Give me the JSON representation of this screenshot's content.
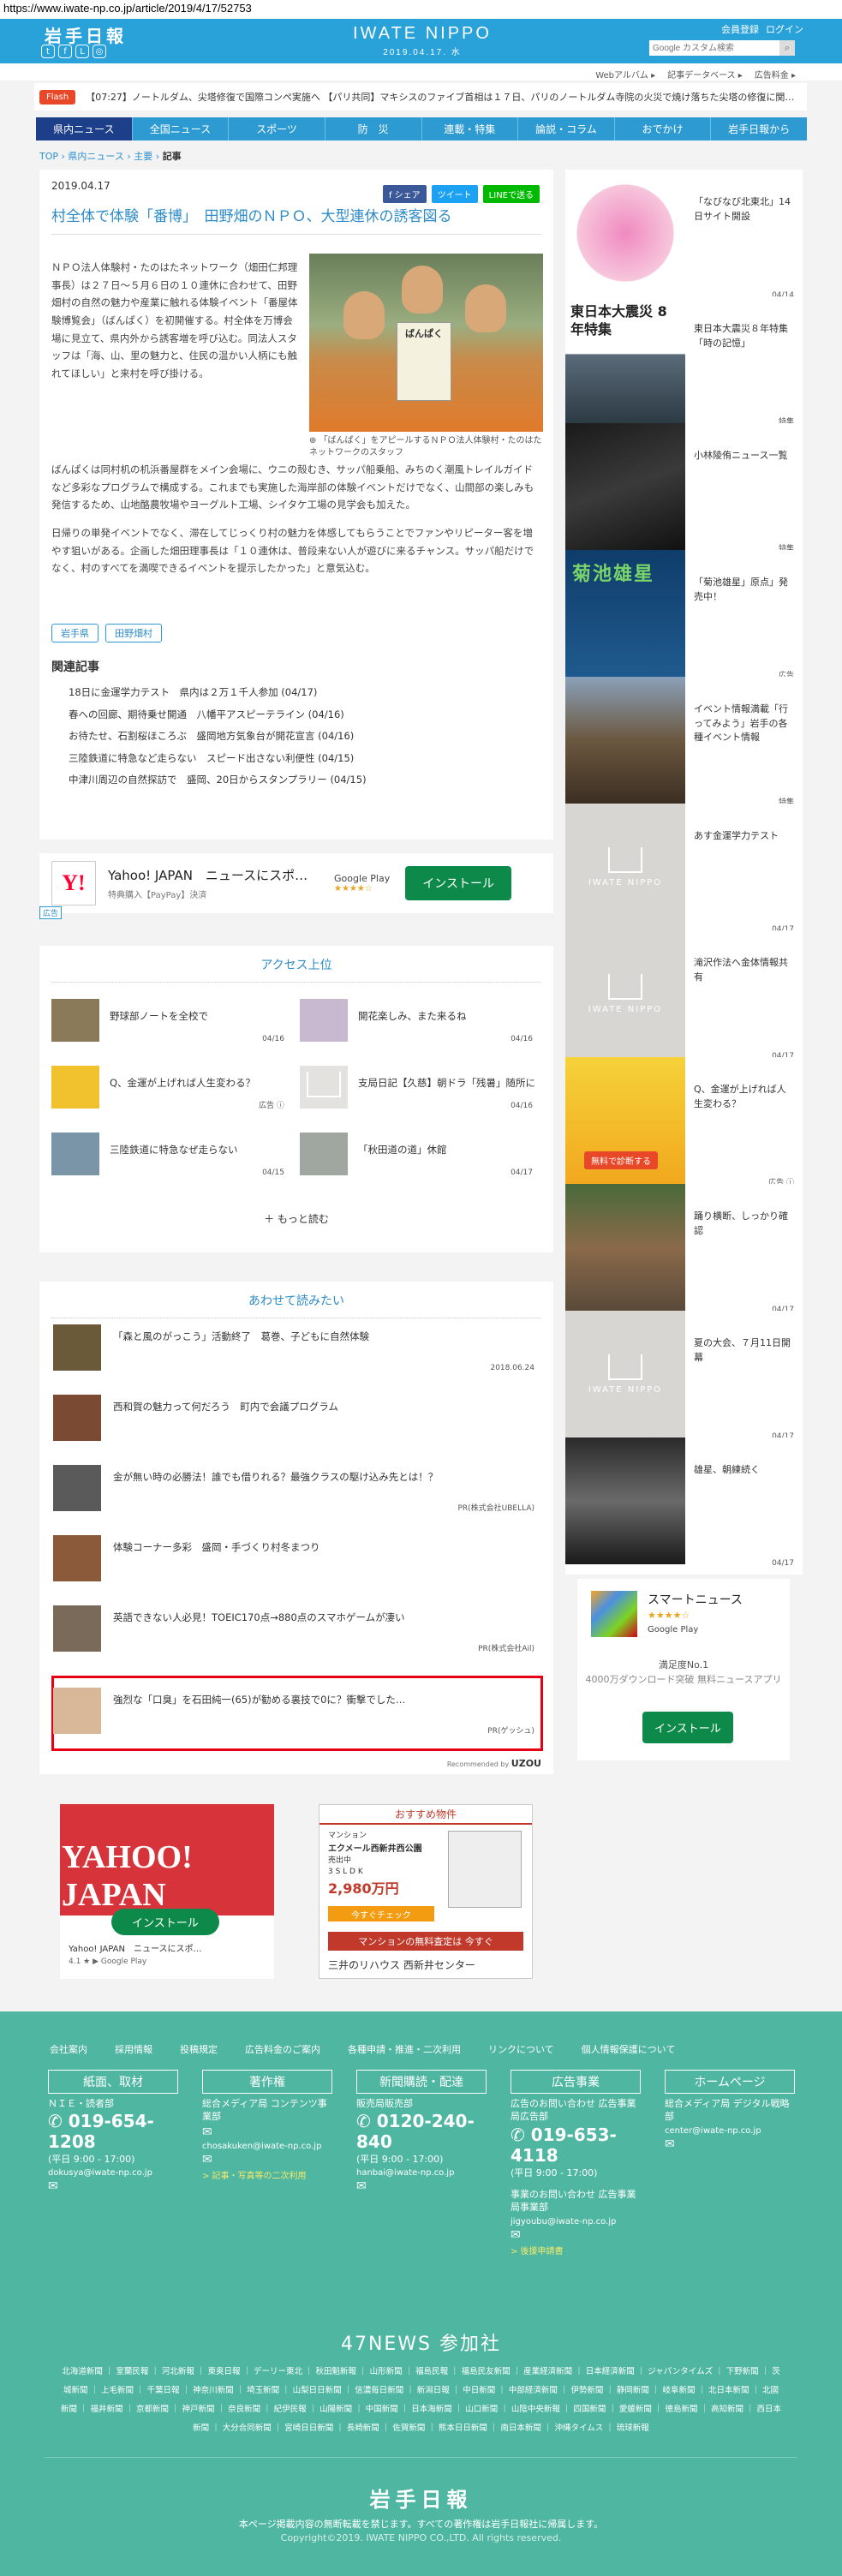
{
  "browser": {
    "url": "https://www.iwate-np.co.jp/article/2019/4/17/52753"
  },
  "header": {
    "logo": "岩手日報",
    "social_icons": [
      "twitter-icon",
      "facebook-icon",
      "line-icon",
      "instagram-icon"
    ],
    "site_name": "IWATE NIPPO",
    "site_date": "2019.04.17. 水",
    "member_register": "会員登録",
    "login": "ログイン",
    "search_placeholder": "Google カスタム検索",
    "brand_color": "#29a1d9"
  },
  "subnav": {
    "items": [
      "Webアルバム ▸",
      "記事データベース ▸",
      "広告料金 ▸"
    ]
  },
  "flash": {
    "label": "Flash",
    "text": "【07:27】ノートルダム、尖塔修復で国際コンペ実施へ 【パリ共同】マキシスのファイブ首相は１７日、パリのノートルダム寺院の火災で焼け落ちた尖塔の修復に関…"
  },
  "nav": {
    "items": [
      "県内ニュース",
      "全国ニュース",
      "スポーツ",
      "防　災",
      "連載・特集",
      "論説・コラム",
      "おでかけ",
      "岩手日報から"
    ],
    "active_color": "#1d3f8a"
  },
  "breadcrumb": {
    "top": "TOP",
    "sep": "›",
    "local": "県内ニュース",
    "main": "主要",
    "current": "記事"
  },
  "article": {
    "date": "2019.04.17",
    "share": {
      "facebook": "f シェア",
      "twitter": "ツイート",
      "line": "LINEで送る"
    },
    "title": "村全体で体験「番博」　田野畑のＮＰＯ、大型連休の誘客図る",
    "photo_book_text": "ばんぱく",
    "photo_caption": "「ばんぱく」をアピールするＮＰＯ法人体験村・たのはたネットワークのスタッフ",
    "para1": "ＮＰＯ法人体験村・たのはたネットワーク（畑田仁邦理事長）は２７日～５月６日の１０連休に合わせて、田野畑村の自然の魅力や産業に触れる体験イベント「番屋体験博覧会」（ばんぱく）を初開催する。村全体を万博会場に見立て、県内外から誘客増を呼び込む。同法人スタッフは「海、山、里の魅力と、住民の温かい人柄にも触れてほしい」と来村を呼び掛ける。",
    "para2": "ばんぱくは同村机の机浜番屋群をメイン会場に、ウニの殻むき、サッパ船乗船、みちのく潮風トレイルガイドなど多彩なプログラムで構成する。これまでも実施した海岸部の体験イベントだけでなく、山間部の楽しみも発信するため、山地酪農牧場やヨーグルト工場、シイタケ工場の見学会も加えた。",
    "para3": "日帰りの単発イベントでなく、滞在してじっくり村の魅力を体感してもらうことでファンやリピーター客を増やす狙いがある。企画した畑田理事長は「１０連休は、普段来ない人が遊びに来るチャンス。サッパ船だけでなく、村のすべてを満喫できるイベントを提示したかった」と意気込む。",
    "tags": [
      "岩手県",
      "田野畑村"
    ],
    "related_heading": "関連記事",
    "related": [
      "18日に金運学力テスト　県内は２万１千人参加 (04/17)",
      "春への回廊、期待乗せ開通　八幡平アスピーテライン (04/16)",
      "お待たせ、石割桜ほころぶ　盛岡地方気象台が開花宣言 (04/16)",
      "三陸鉄道に特急など走らない　スピード出さない利便性 (04/15)",
      "中津川周辺の自然探訪で　盛岡、20日からスタンプラリー (04/15)"
    ]
  },
  "app_banner": {
    "logo": "Y!",
    "name": "Yahoo! JAPAN　ニュースにスポ…",
    "sub": "特典購入【PayPay】決済",
    "store": "Google Play",
    "stars": "★★★★☆",
    "install": "インストール",
    "ad_label": "広告"
  },
  "access": {
    "heading": "アクセス上位",
    "items": [
      {
        "title": "野球部ノートを全校で",
        "date": "04/16"
      },
      {
        "title": "開花楽しみ、また来るね",
        "date": "04/16"
      },
      {
        "title": "Q、金運が上げれば人生変わる？",
        "date": "広告 ⓘ"
      },
      {
        "title": "支局日記【久慈】朝ドラ「残暑」随所に",
        "date": "04/16"
      },
      {
        "title": "三陸鉄道に特急なぜ走らない",
        "date": "04/15"
      },
      {
        "title": "「秋田道の道」休館",
        "date": "04/17"
      }
    ],
    "more": "＋ もっと読む"
  },
  "recommend": {
    "heading": "あわせて読みたい",
    "items": [
      {
        "title": "「森と風のがっこう」活動終了　葛巻、子どもに自然体験",
        "date": "2018.06.24"
      },
      {
        "title": "西和賀の魅力って何だろう　町内で会議プログラム",
        "date": ""
      },
      {
        "title": "金が無い時の必勝法！誰でも借りれる？最強クラスの駆け込み先とは！？",
        "date": "PR(株式会社UBELLA)"
      },
      {
        "title": "体験コーナー多彩　盛岡・手づくり村冬まつり",
        "date": ""
      },
      {
        "title": "英語できない人必見！TOEIC170点→880点のスマホゲームが凄い",
        "date": "PR(株式会社Ail)"
      },
      {
        "title": "強烈な「口臭」を石田純一(65)が勧める裏技で0に？衝撃でした…",
        "date": "PR(ゲッシュ)"
      }
    ],
    "recommended_by": "Recommended by",
    "uzou": "UZOU"
  },
  "bottom_ads": {
    "yahoo_logo": "YAHOO! JAPAN",
    "yahoo_install": "インストール",
    "yahoo_caption": "Yahoo! JAPAN　ニュースにスポ…",
    "yahoo_rating": "4.1 ★ ▶ Google Play",
    "re_header": "おすすめ物件",
    "re_type": "マンション",
    "re_name": "エクメール西新井西公園",
    "re_status": "売出中",
    "re_ldk": "3 S L D K",
    "re_price": "2,980万円",
    "re_cta": "今すぐチェック",
    "re_appraisal": "マンションの無料査定は 今すぐ",
    "re_footer": "三井のリハウス 西新井センター"
  },
  "sidebar": {
    "items": [
      {
        "title": "「なびなび北東北」14日サイト開設",
        "date": "04/14"
      },
      {
        "title": "東日本大震災８年特集「時の記憶」",
        "date": "特集",
        "thumb_text": "東日本大震災 8年特集"
      },
      {
        "title": "小林陵侑ニュース一覧",
        "date": "特集"
      },
      {
        "title": "「菊池雄星」原点」発売中！",
        "date": "広告",
        "thumb_text": "菊池雄星"
      },
      {
        "title": "イベント情報満載「行ってみよう」岩手の各種イベント情報",
        "date": "特集"
      },
      {
        "title": "あす金運学力テスト",
        "date": "04/17"
      },
      {
        "title": "滝沢作法へ金体情報共有",
        "date": "04/17"
      },
      {
        "title": "Q、金運が上げれば人生変わる？",
        "date": "広告 ⓘ",
        "thumb_text": "無料で診断する"
      },
      {
        "title": "踊り横断、しっかり確認",
        "date": "04/17"
      },
      {
        "title": "夏の大会、７月11日開幕",
        "date": "04/17"
      },
      {
        "title": "雄星、朝練続く",
        "date": "04/17"
      }
    ],
    "placeholder_logo": "IWATE NIPPO"
  },
  "smart_news": {
    "name": "スマートニュース",
    "stars": "★★★★☆",
    "store": "Google Play",
    "line1": "満足度No.1",
    "line2": "4000万ダウンロード突破 無料ニュースアプリ",
    "install": "インストール"
  },
  "footer": {
    "links": [
      "会社案内",
      "採用情報",
      "投稿規定",
      "広告料金のご案内",
      "各種申請・推進・二次利用",
      "リンクについて",
      "個人情報保護について"
    ],
    "cols": [
      {
        "head": "紙面、取材",
        "sub": "ＮＩＥ・読者部",
        "tel": "019-654-1208",
        "time": "(平日 9:00 - 17:00)",
        "email": "dokusya@iwate-np.co.jp",
        "link": ""
      },
      {
        "head": "著作権",
        "sub": "総合メディア局 コンテンツ事業部",
        "tel": "",
        "time": "",
        "email": "chosakuken@iwate-np.co.jp",
        "link": "> 記事・写真等の二次利用"
      },
      {
        "head": "新聞購読・配達",
        "sub": "販売局販売部",
        "tel": "0120-240-840",
        "time": "(平日 9:00 - 17:00)",
        "email": "hanbai@iwate-np.co.jp",
        "link": ""
      },
      {
        "head": "広告事業",
        "sub": "広告のお問い合わせ 広告事業局広告部",
        "tel": "019-653-4118",
        "time": "(平日 9:00 - 17:00)",
        "email": "jigyoubu@iwate-np.co.jp",
        "link": "> 後援申請書",
        "sub2": "事業のお問い合わせ 広告事業局事業部"
      },
      {
        "head": "ホームページ",
        "sub": "総合メディア局 デジタル戦略部",
        "tel": "",
        "time": "",
        "email": "center@iwate-np.co.jp",
        "link": ""
      }
    ],
    "n47_title": "47NEWS 参加社",
    "papers": "北海道新聞 ｜ 室蘭民報 ｜ 河北新報 ｜ 東奥日報 ｜ デーリー東北 ｜ 秋田魁新報 ｜ 山形新聞 ｜ 福島民報 ｜ 福島民友新聞 ｜ 産業経済新聞 ｜ 日本経済新聞 ｜ ジャパンタイムズ ｜ 下野新聞 ｜ 茨城新聞 ｜ 上毛新聞 ｜ 千葉日報 ｜ 神奈川新聞 ｜ 埼玉新聞 ｜ 山梨日日新聞 ｜ 信濃毎日新聞 ｜ 新潟日報 ｜ 中日新聞 ｜ 中部経済新聞 ｜ 伊勢新聞 ｜ 静岡新聞 ｜ 岐阜新聞 ｜ 北日本新聞 ｜ 北國新聞 ｜ 福井新聞 ｜ 京都新聞 ｜ 神戸新聞 ｜ 奈良新聞 ｜ 紀伊民報 ｜ 山陽新聞 ｜ 中国新聞 ｜ 日本海新聞 ｜ 山口新聞 ｜ 山陰中央新報 ｜ 四国新聞 ｜ 愛媛新聞 ｜ 徳島新聞 ｜ 高知新聞 ｜ 西日本新聞 ｜ 大分合同新聞 ｜ 宮崎日日新聞 ｜ 長崎新聞 ｜ 佐賀新聞 ｜ 熊本日日新聞 ｜ 南日本新聞 ｜ 沖縄タイムス ｜ 琉球新報",
    "logo": "岩手日報",
    "notice": "本ページ掲載内容の無断転載を禁じます。すべての著作権は岩手日報社に帰属します。",
    "copyright": "Copyright©2019. IWATE NIPPO CO.,LTD. All rights reserved.",
    "bg_color": "#4fb7a1"
  }
}
